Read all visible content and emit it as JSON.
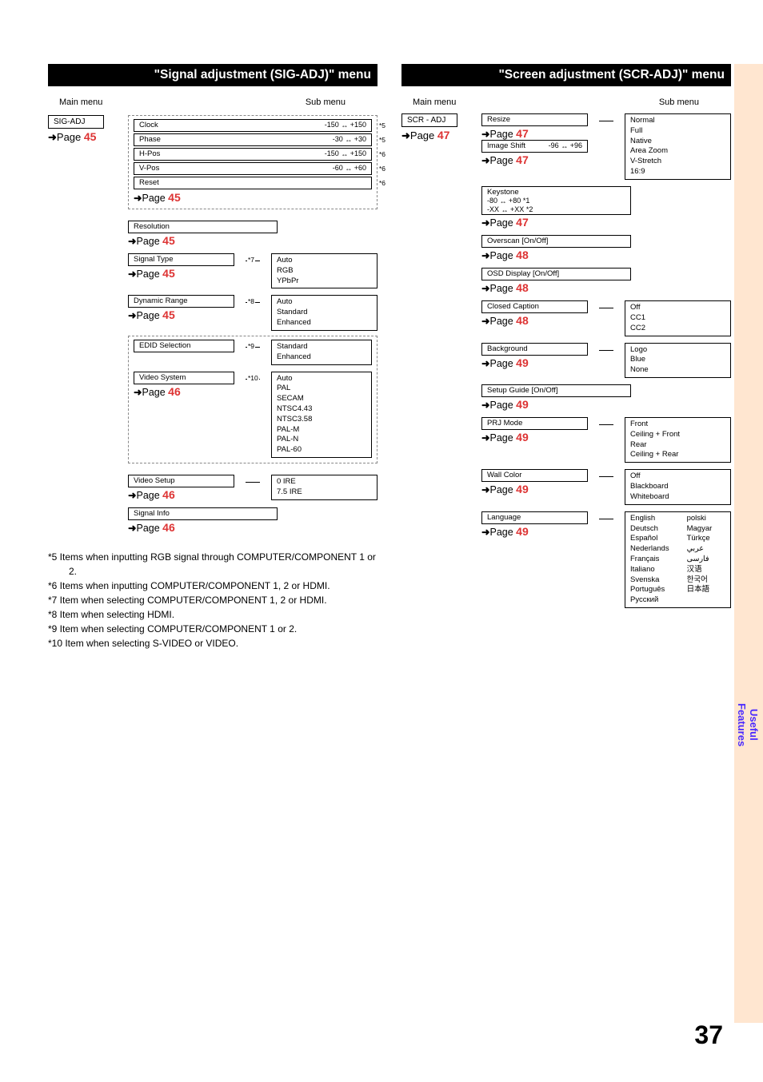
{
  "pageNumber": "37",
  "sideTab": {
    "line1": "Useful",
    "line2": "Features"
  },
  "left": {
    "header": "\"Signal adjustment (SIG-ADJ)\" menu",
    "mainLabel": "Main menu",
    "subLabel": "Sub menu",
    "root": {
      "name": "SIG-ADJ",
      "page": "45"
    },
    "params": [
      {
        "name": "Clock",
        "range1": "-150",
        "range2": "+150",
        "note": "*5"
      },
      {
        "name": "Phase",
        "range1": "-30",
        "range2": "+30",
        "note": "*5"
      },
      {
        "name": "H-Pos",
        "range1": "-150",
        "range2": "+150",
        "note": "*6"
      },
      {
        "name": "V-Pos",
        "range1": "-60",
        "range2": "+60",
        "note": "*6"
      },
      {
        "name": "Reset",
        "note": "*6"
      }
    ],
    "paramsPage": "45",
    "resolution": {
      "name": "Resolution",
      "page": "45"
    },
    "signalType": {
      "name": "Signal Type",
      "note": "*7",
      "page": "45",
      "options": [
        "Auto",
        "RGB",
        "YPbPr"
      ]
    },
    "dynamicRange": {
      "name": "Dynamic Range",
      "note": "*8",
      "page": "45",
      "options": [
        "Auto",
        "Standard",
        "Enhanced"
      ]
    },
    "edid": {
      "name": "EDID Selection",
      "note": "*9",
      "options": [
        "Standard",
        "Enhanced"
      ]
    },
    "videoSystem": {
      "name": "Video System",
      "note": "*10",
      "page": "46",
      "options": [
        "Auto",
        "PAL",
        "SECAM",
        "NTSC4.43",
        "NTSC3.58",
        "PAL-M",
        "PAL-N",
        "PAL-60"
      ]
    },
    "videoSetup": {
      "name": "Video Setup",
      "page": "46",
      "options": [
        "0 IRE",
        "7.5 IRE"
      ]
    },
    "signalInfo": {
      "name": "Signal Info",
      "page": "46"
    },
    "footnotes": [
      "*5  Items when inputting RGB signal through COMPUTER/COMPONENT 1 or 2.",
      "*6  Items when inputting COMPUTER/COMPONENT 1, 2 or HDMI.",
      "*7  Item when selecting COMPUTER/COMPONENT 1, 2 or HDMI.",
      "*8  Item when selecting HDMI.",
      "*9  Item when selecting COMPUTER/COMPONENT 1 or 2.",
      "*10 Item when selecting S-VIDEO or VIDEO."
    ]
  },
  "right": {
    "header": "\"Screen adjustment (SCR-ADJ)\" menu",
    "mainLabel": "Main menu",
    "subLabel": "Sub menu",
    "root": {
      "name": "SCR - ADJ",
      "page": "47"
    },
    "resize": {
      "name": "Resize",
      "page": "47",
      "options": [
        "Normal",
        "Full",
        "Native",
        "Area Zoom",
        "V-Stretch",
        "16:9"
      ]
    },
    "imageShift": {
      "name": "Image Shift",
      "range1": "-96",
      "range2": "+96",
      "page": "47"
    },
    "keystone": {
      "name": "Keystone",
      "line1a": "-80",
      "line1b": "+80",
      "line1n": "*1",
      "line2a": "-XX",
      "line2b": "+XX",
      "line2n": "*2",
      "page": "47"
    },
    "overscan": {
      "name": "Overscan [On/Off]",
      "page": "48"
    },
    "osd": {
      "name": "OSD Display [On/Off]",
      "page": "48"
    },
    "cc": {
      "name": "Closed Caption",
      "page": "48",
      "options": [
        "Off",
        "CC1",
        "CC2"
      ]
    },
    "background": {
      "name": "Background",
      "page": "49",
      "options": [
        "Logo",
        "Blue",
        "None"
      ]
    },
    "setupGuide": {
      "name": "Setup Guide [On/Off]",
      "page": "49"
    },
    "prj": {
      "name": "PRJ Mode",
      "page": "49",
      "options": [
        "Front",
        "Ceiling + Front",
        "Rear",
        "Ceiling + Rear"
      ]
    },
    "wall": {
      "name": "Wall Color",
      "page": "49",
      "options": [
        "Off",
        "Blackboard",
        "Whiteboard"
      ]
    },
    "language": {
      "name": "Language",
      "page": "49",
      "col1": [
        "English",
        "Deutsch",
        "Español",
        "Nederlands",
        "Français",
        "Italiano",
        "Svenska",
        "Português",
        "Русский"
      ],
      "col2": [
        "polski",
        "Magyar",
        "Türkçe",
        "عربي",
        "فارسی",
        "汉语",
        "한국어",
        "日本語"
      ]
    }
  }
}
